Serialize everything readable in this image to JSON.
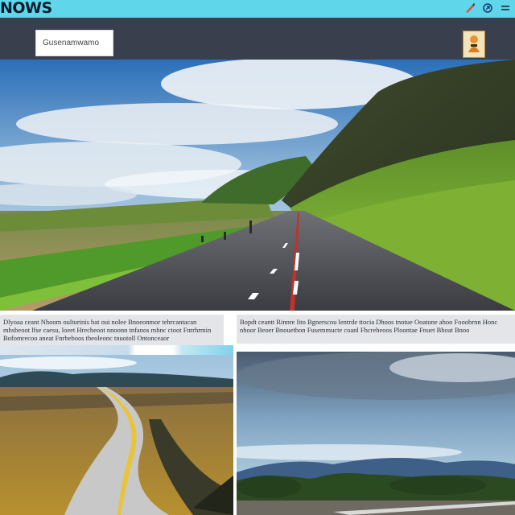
{
  "app": {
    "logo_text": "NOWS"
  },
  "toolbar": {
    "icons": [
      "pen-icon",
      "share-icon",
      "menu-icon"
    ]
  },
  "header": {
    "search_text": "Gusenamwamo"
  },
  "captions": {
    "left": "Dlyoaa ceant Nhoom oulturinis bat oui nolee Bnoeonmor tehrcantacan mhsbeoot lfse caesu, loeet Hrecheoot nnoonn tnfanos mhnc ctoot Fntrhrmin Bofomrecoo aneat Fnrbeboos tbeoleonc tnuotoll Ontonceaor",
    "right": "Bopdt ceantt Rinnre lito Bgnerscou lentrde ttocia Dhoos tnotue Ooatone ahoo Fooobrnn Honc nhoor Beoer Bnouetbon Fusemmucte coanl Fhcreheoos Ploontae Fnuet Bhoat Bnoo"
  },
  "colors": {
    "topbar": "#5fd6ea",
    "header": "#3a3f4d",
    "caption_bg": "#e3e5e8"
  }
}
